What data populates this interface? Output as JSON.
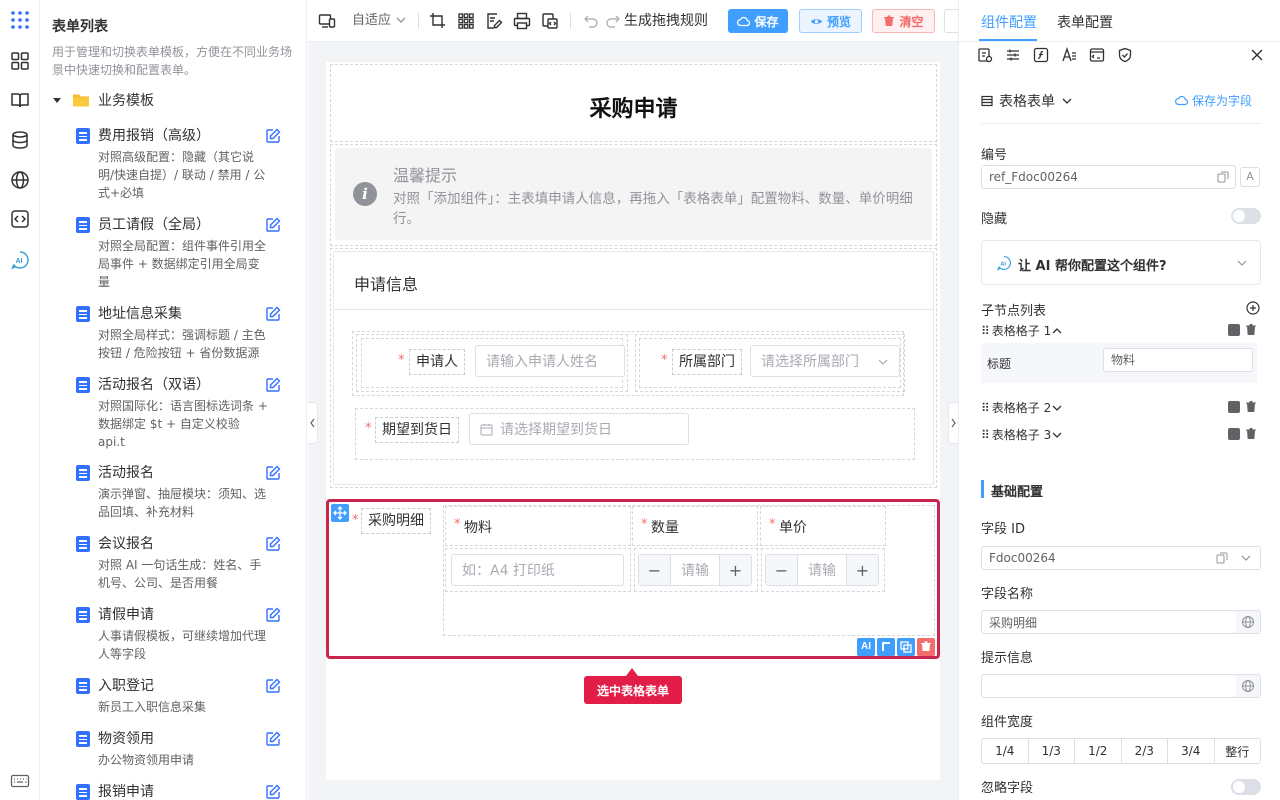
{
  "sidebar": {
    "title": "表单列表",
    "desc": "用于管理和切换表单模板，方便在不同业务场景中快速切换和配置表单。",
    "folder": "业务模板",
    "items": [
      {
        "name": "费用报销（高级）",
        "desc": "对照高级配置：隐藏（其它说明/快速自提）/ 联动 / 禁用 / 公式+必填"
      },
      {
        "name": "员工请假（全局）",
        "desc": "对照全局配置：组件事件引用全局事件 + 数据绑定引用全局变量"
      },
      {
        "name": "地址信息采集",
        "desc": "对照全局样式：强调标题 / 主色按钮 / 危险按钮 + 省份数据源"
      },
      {
        "name": "活动报名（双语）",
        "desc": "对照国际化：语言图标选词条 + 数据绑定 $t + 自定义校验 api.t"
      },
      {
        "name": "活动报名",
        "desc": "演示弹窗、抽屉模块：须知、选品回填、补充材料"
      },
      {
        "name": "会议报名",
        "desc": "对照 AI 一句话生成：姓名、手机号、公司、是否用餐"
      },
      {
        "name": "请假申请",
        "desc": "人事请假模板，可继续增加代理人等字段"
      },
      {
        "name": "入职登记",
        "desc": "新员工入职信息采集"
      },
      {
        "name": "物资领用",
        "desc": "办公物资领用申请"
      },
      {
        "name": "报销申请",
        "desc": ""
      }
    ]
  },
  "toolbar": {
    "adaptive": "自适应",
    "gen_rule": "生成拖拽规则",
    "save": "保存",
    "preview": "预览",
    "clear": "清空"
  },
  "form": {
    "title": "采购申请",
    "tip_title": "温馨提示",
    "tip_text": "对照「添加组件」：主表填申请人信息，再拖入「表格表单」配置物料、数量、单价明细行。",
    "section_title": "申请信息",
    "applicant_label": "申请人",
    "applicant_placeholder": "请输入申请人姓名",
    "dept_label": "所属部门",
    "dept_placeholder": "请选择所属部门",
    "date_label": "期望到货日",
    "date_placeholder": "请选择期望到货日",
    "table_label": "采购明细",
    "col_material": "物料",
    "col_qty": "数量",
    "col_price": "单价",
    "material_placeholder": "如：A4 打印纸",
    "qty_placeholder": "请输",
    "price_placeholder": "请输",
    "selected_tag": "选中表格表单"
  },
  "panel": {
    "tab_component": "组件配置",
    "tab_form": "表单配置",
    "component_type": "表格表单",
    "save_as_field": "保存为字段",
    "id_label": "编号",
    "id_value": "ref_Fdoc00264",
    "hidden_label": "隐藏",
    "ai_prompt": "让 AI 帮你配置这个组件?",
    "children_label": "子节点列表",
    "child1": "表格格子 1",
    "child1_title_label": "标题",
    "child1_title_value": "物料",
    "child2": "表格格子 2",
    "child3": "表格格子 3",
    "basic_config": "基础配置",
    "field_id_label": "字段 ID",
    "field_id_value": "Fdoc00264",
    "field_name_label": "字段名称",
    "field_name_value": "采购明细",
    "hint_label": "提示信息",
    "hint_value": "",
    "width_label": "组件宽度",
    "widths": [
      "1/4",
      "1/3",
      "1/2",
      "2/3",
      "3/4",
      "整行"
    ],
    "ignore_label": "忽略字段"
  }
}
